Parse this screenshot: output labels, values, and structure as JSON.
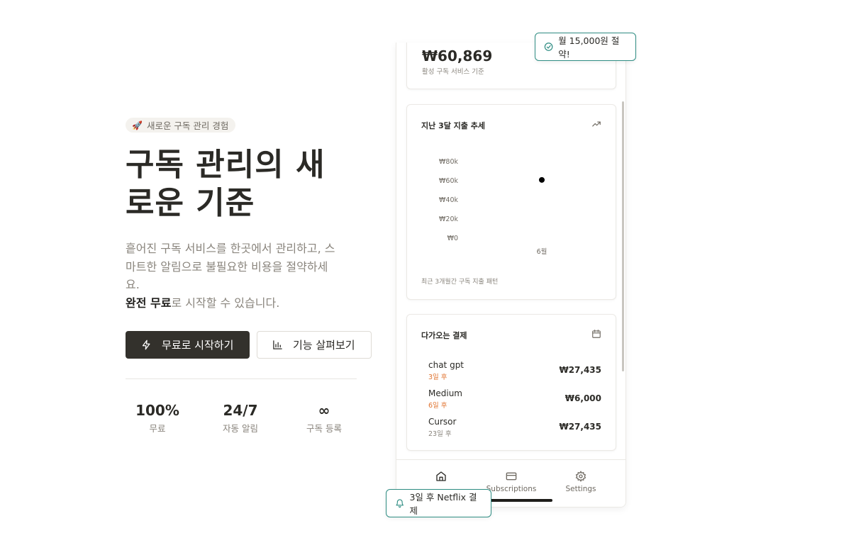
{
  "hero": {
    "badge": "새로운 구독 관리 경험",
    "title": "구독 관리의 새로운 기준",
    "desc_line1": "흩어진 구독 서비스를 한곳에서 관리하고, 스",
    "desc_line2": "마트한 알림으로 불필요한 비용을 절약하세",
    "desc_line3": "요.",
    "desc_bold": "완전 무료",
    "desc_rest": "로 시작할 수 있습니다.",
    "primary_button": "무료로 시작하기",
    "secondary_button": "기능 살펴보기"
  },
  "stats": [
    {
      "value": "100%",
      "label": "무료"
    },
    {
      "value": "24/7",
      "label": "자동 알림"
    },
    {
      "value": "∞",
      "label": "구독 등록"
    }
  ],
  "phone": {
    "total_amount": "₩60,869",
    "total_caption": "활성 구독 서비스 기준",
    "trend_title": "지난 3달 지출 추세",
    "trend_footer": "최근 3개월간 구독 지출 패턴",
    "upcoming_title": "다가오는 결제",
    "payments": [
      {
        "name": "chat gpt",
        "due": "3일 후",
        "amount": "₩27,435",
        "urgent": true
      },
      {
        "name": "Medium",
        "due": "6일 후",
        "amount": "₩6,000",
        "urgent": true
      },
      {
        "name": "Cursor",
        "due": "23일 후",
        "amount": "₩27,435",
        "urgent": false
      }
    ],
    "tabs": [
      {
        "label": "",
        "icon": "home-icon"
      },
      {
        "label": "Subscriptions",
        "icon": "card-icon"
      },
      {
        "label": "Settings",
        "icon": "gear-icon"
      }
    ]
  },
  "chart_data": {
    "type": "scatter",
    "x": [
      "6월"
    ],
    "values": [
      60869
    ],
    "ytick_labels": [
      "₩80k",
      "₩60k",
      "₩40k",
      "₩20k",
      "₩0"
    ],
    "ylim": [
      0,
      80000
    ],
    "grid": false
  },
  "toasts": {
    "savings": "월 15,000원 절약!",
    "netflix": "3일 후 Netflix 결제"
  },
  "colors": {
    "primary": "#33312c",
    "accent_teal": "#2f8d83",
    "urgent_orange": "#e0732f",
    "muted_text": "#8a857d"
  }
}
